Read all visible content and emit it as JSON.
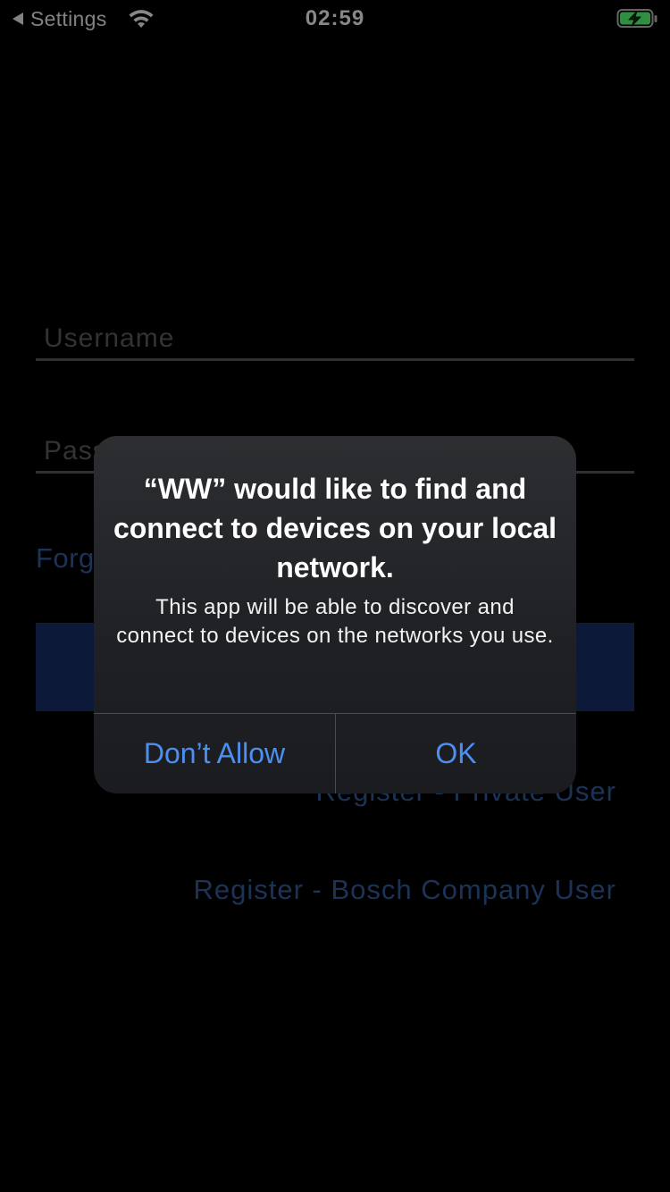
{
  "status_bar": {
    "back_label": "Settings",
    "time": "02:59",
    "wifi_icon": "wifi-icon",
    "battery_icon": "battery-charging-icon",
    "battery_color": "#4cd964"
  },
  "login": {
    "username_placeholder": "Username",
    "password_placeholder": "Password",
    "forgot_label": "Forg",
    "register_private": "Register - Private User",
    "register_bosch": "Register - Bosch Company User",
    "accent_color": "#2c4f86",
    "button_color": "#142757"
  },
  "alert": {
    "title": "“WW” would like to find and connect to devices on your local network.",
    "message": "This app will be able to discover and connect to devices on the networks you use.",
    "deny_label": "Don’t Allow",
    "ok_label": "OK",
    "button_color": "#4d8ff0"
  }
}
